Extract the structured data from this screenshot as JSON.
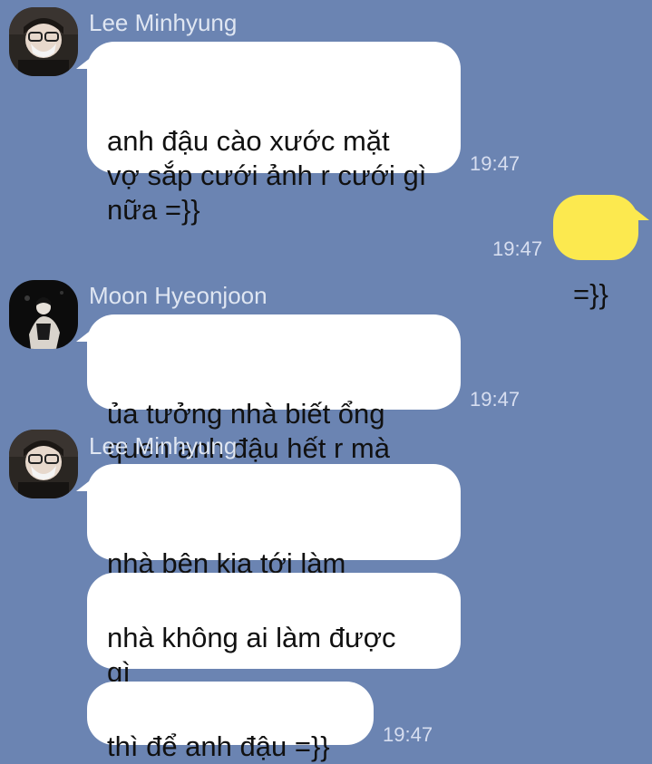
{
  "chat": {
    "messages": [
      {
        "sender": "Lee Minhyung",
        "avatar": "avatar-lee-minhyung",
        "text": "anh đậu cào xước mặt\nvợ sắp cưới ảnh r cưới gì\nnữa =}}",
        "time": "19:47"
      },
      {
        "sender": "me",
        "text": "=}}",
        "time": "19:47"
      },
      {
        "sender": "Moon Hyeonjoon",
        "avatar": "avatar-moon-hyeonjoon",
        "text": "ủa tưởng nhà biết ổng\nquen anh đậu hết r mà",
        "time": "19:47"
      },
      {
        "sender": "Lee Minhyung",
        "avatar": "avatar-lee-minhyung",
        "text": "nhà bên kia tới làm\nkhùng làm điên thôi"
      },
      {
        "sender": "Lee Minhyung",
        "text": "nhà không ai làm được\ngì"
      },
      {
        "sender": "Lee Minhyung",
        "text": "thì để anh đậu =}}",
        "time": "19:47"
      }
    ]
  },
  "colors": {
    "background": "#6b84b2",
    "incoming_bubble": "#ffffff",
    "outgoing_bubble": "#fce94f"
  }
}
